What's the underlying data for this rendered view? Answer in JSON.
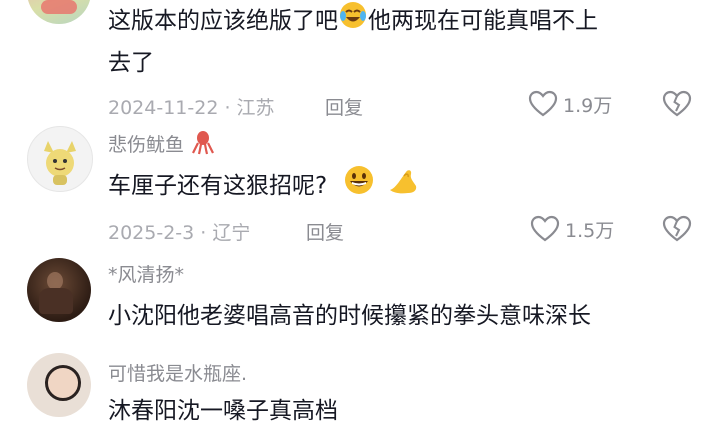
{
  "colors": {
    "text": "#161823",
    "secondary": "#8a8b91",
    "meta": "#a9aab0",
    "emoji_yellow": "#f7c02e"
  },
  "comments": [
    {
      "text_line1": "这版本的应该绝版了吧",
      "text_line1b": "他两现在可能真唱不上",
      "text_line2": "去了",
      "emoji": "laughing-crying-emoji",
      "date_location": "2024-11-22 · 江苏",
      "reply_label": "回复",
      "like_count": "1.9万"
    },
    {
      "username": "悲伤鱿鱼",
      "username_icon": "squid-icon",
      "text": "车厘子还有这狠招呢?",
      "emojis": [
        "grinning-face-emoji",
        "pinching-hand-emoji"
      ],
      "date_location": "2025-2-3 · 辽宁",
      "reply_label": "回复",
      "like_count": "1.5万"
    },
    {
      "username": "*风清扬*",
      "text": "小沈阳他老婆唱高音的时候攥紧的拳头意味深长"
    },
    {
      "username": "可惜我是水瓶座.",
      "text": "沐春阳沈一嗓子真高档"
    }
  ]
}
